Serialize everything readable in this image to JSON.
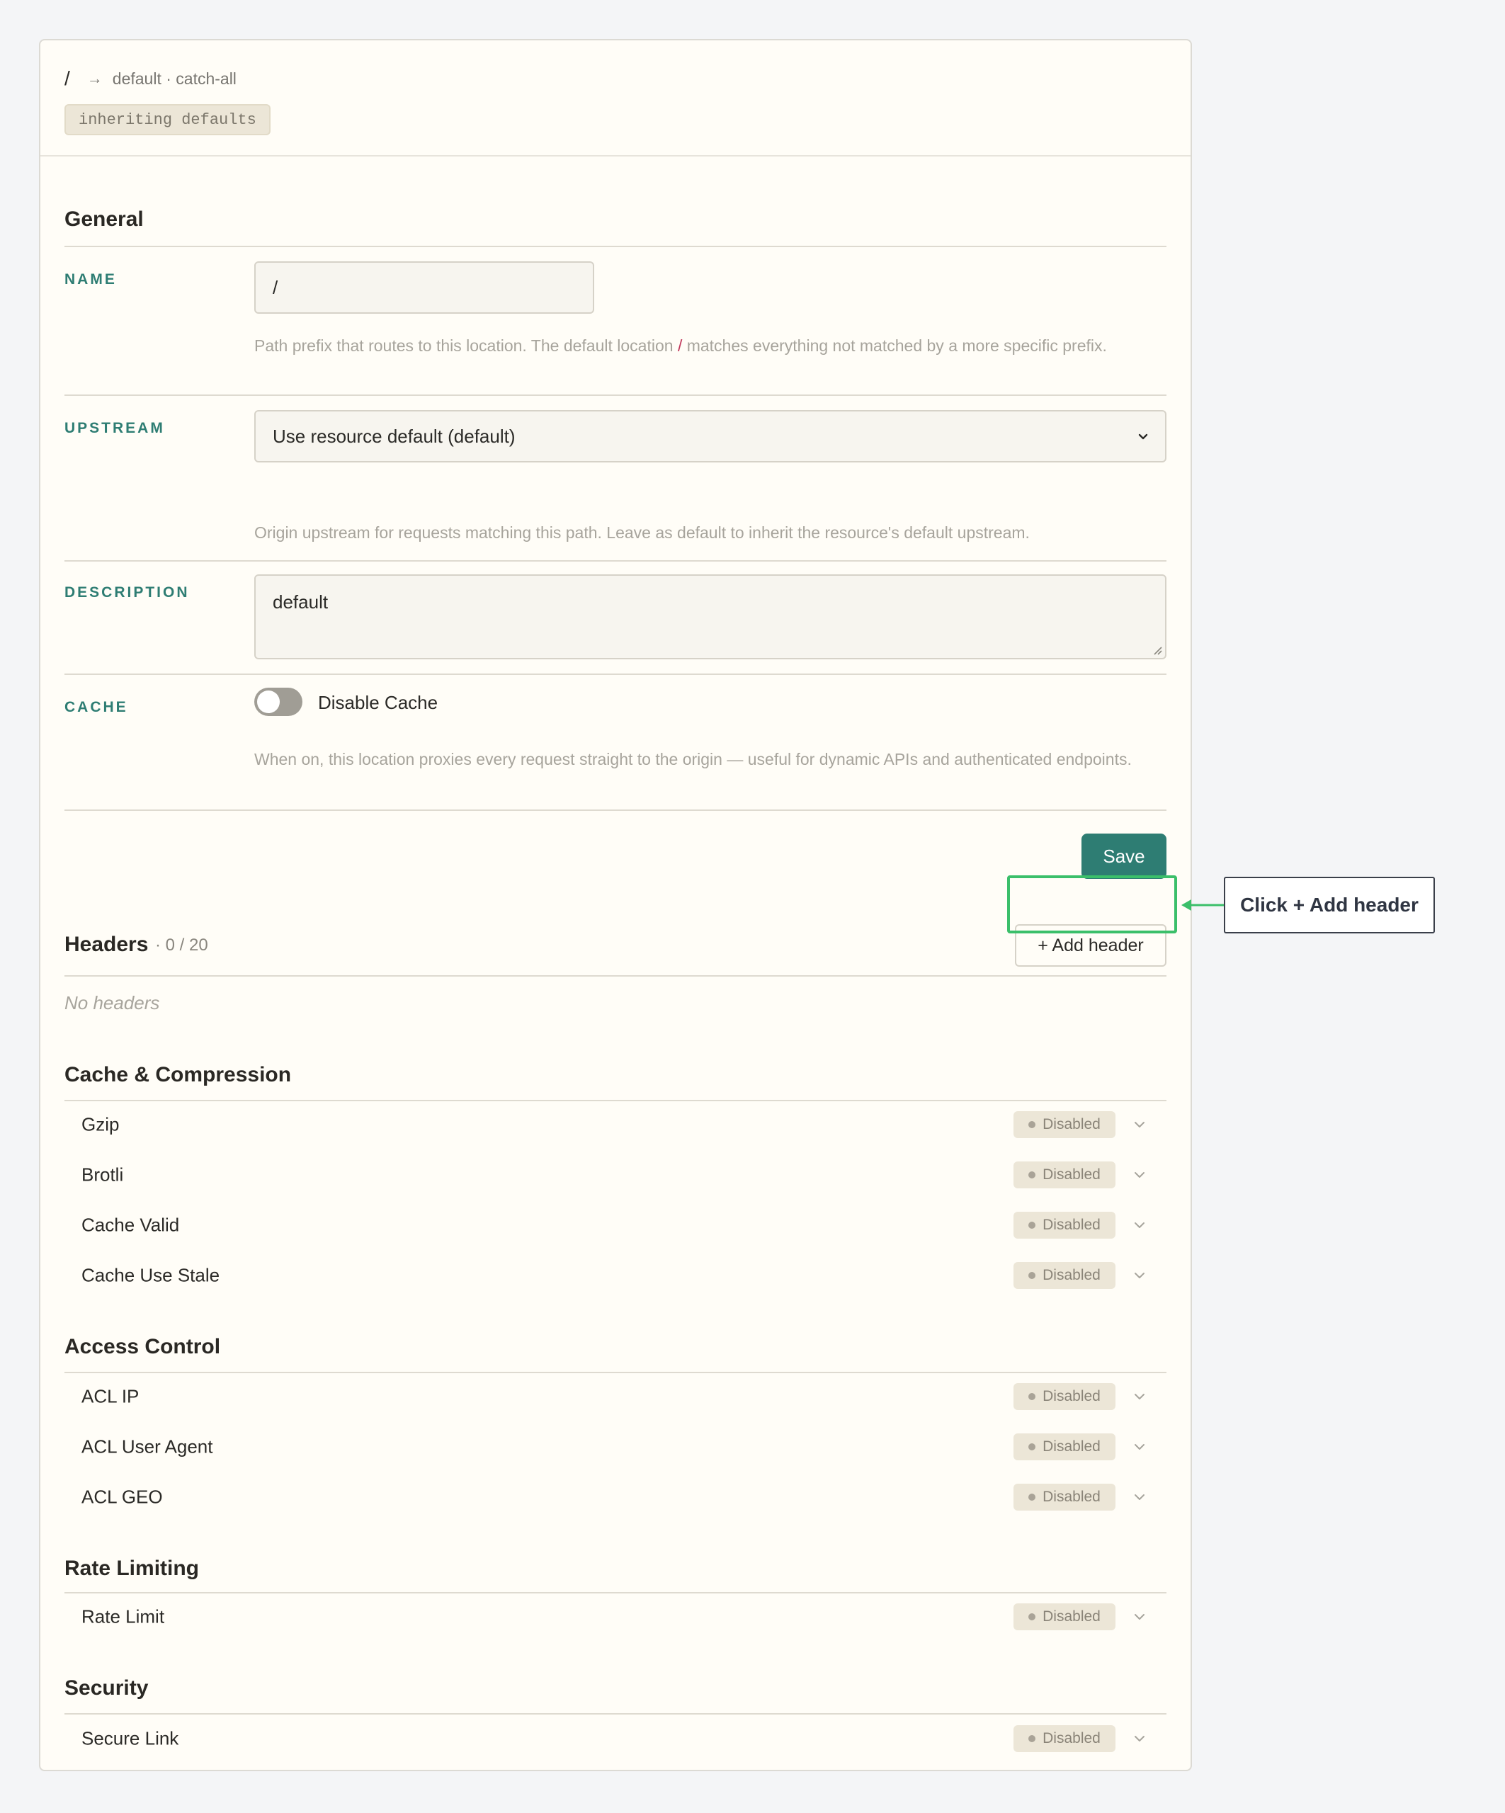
{
  "breadcrumb": {
    "root": "/",
    "arrow": "→",
    "target": "default · catch-all"
  },
  "inherit_pill": "inheriting defaults",
  "general": {
    "title": "General",
    "name": {
      "label": "NAME",
      "value": "/",
      "hint_before": "Path prefix that routes to this location. The default location ",
      "hint_code": "/",
      "hint_after": " matches everything not matched by a more specific prefix."
    },
    "upstream": {
      "label": "UPSTREAM",
      "value": "Use resource default (default)",
      "hint": "Origin upstream for requests matching this path. Leave as default to inherit the resource's default upstream."
    },
    "description": {
      "label": "DESCRIPTION",
      "value": "default"
    },
    "cache": {
      "label": "CACHE",
      "toggle_label": "Disable Cache",
      "toggle_on": false,
      "hint": "When on, this location proxies every request straight to the origin — useful for dynamic APIs and authenticated endpoints."
    },
    "save_label": "Save"
  },
  "headers": {
    "title": "Headers",
    "count": "· 0 / 20",
    "add_label": "+ Add header",
    "empty": "No headers"
  },
  "groups": {
    "cache": {
      "title": "Cache & Compression",
      "items": [
        {
          "label": "Gzip",
          "status": "Disabled"
        },
        {
          "label": "Brotli",
          "status": "Disabled"
        },
        {
          "label": "Cache Valid",
          "status": "Disabled"
        },
        {
          "label": "Cache Use Stale",
          "status": "Disabled"
        }
      ]
    },
    "access": {
      "title": "Access Control",
      "items": [
        {
          "label": "ACL IP",
          "status": "Disabled"
        },
        {
          "label": "ACL User Agent",
          "status": "Disabled"
        },
        {
          "label": "ACL GEO",
          "status": "Disabled"
        }
      ]
    },
    "rate": {
      "title": "Rate Limiting",
      "items": [
        {
          "label": "Rate Limit",
          "status": "Disabled"
        }
      ]
    },
    "security": {
      "title": "Security",
      "items": [
        {
          "label": "Secure Link",
          "status": "Disabled"
        }
      ]
    }
  },
  "annotation": {
    "callout": "Click + Add header"
  },
  "colors": {
    "accent": "#2e7d73",
    "highlight": "#3bbf6a",
    "background": "#fffdf7"
  }
}
